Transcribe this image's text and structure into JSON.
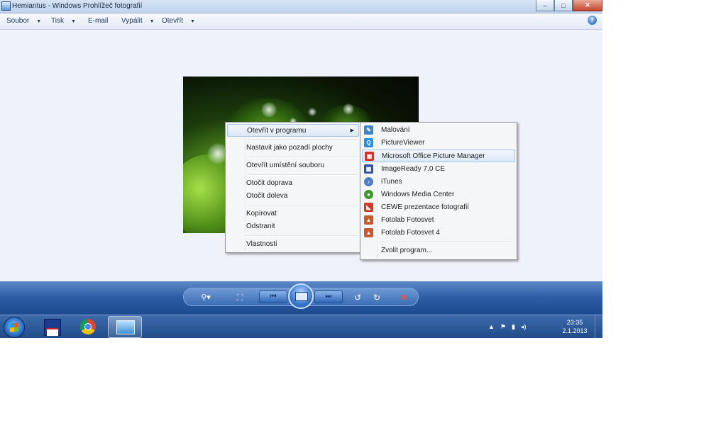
{
  "window": {
    "title": "Hemiantus - Windows Prohlížeč fotografií",
    "buttons": {
      "minimize": "–",
      "maximize": "□",
      "close": "✕"
    }
  },
  "menubar": {
    "items": [
      {
        "label": "Soubor"
      },
      {
        "label": "Tisk"
      },
      {
        "label": "E-mail"
      },
      {
        "label": "Vypálit"
      },
      {
        "label": "Otevřít"
      }
    ],
    "help_glyph": "?"
  },
  "context_menu": {
    "items": [
      {
        "label": "Otevřít v programu",
        "has_submenu": true,
        "highlighted": true
      },
      {
        "label": "Nastavit jako pozadí plochy"
      },
      {
        "label": "Otevřít umístění souboru"
      },
      {
        "label": "Otočit doprava"
      },
      {
        "label": "Otočit doleva"
      },
      {
        "label": "Kopírovat"
      },
      {
        "label": "Odstranit"
      },
      {
        "label": "Vlastnosti"
      }
    ],
    "submenu_arrow": "▶"
  },
  "submenu": {
    "items": [
      {
        "label": "Malování",
        "icon": "paint-icon",
        "color": "#3f86c9",
        "glyph": "✎"
      },
      {
        "label": "PictureViewer",
        "icon": "pictureviewer-icon",
        "color": "#2d8fe0",
        "glyph": "Q"
      },
      {
        "label": "Microsoft Office Picture Manager",
        "icon": "office-picture-manager-icon",
        "color": "#c7352b",
        "glyph": "▣",
        "highlighted": true
      },
      {
        "label": "ImageReady 7.0 CE",
        "icon": "imageready-icon",
        "color": "#3355a8",
        "glyph": "▦"
      },
      {
        "label": "iTunes",
        "icon": "itunes-icon",
        "color": "#4d7fc4",
        "glyph": "♪"
      },
      {
        "label": "Windows Media Center",
        "icon": "media-center-icon",
        "color": "#3a9a2c",
        "glyph": "●"
      },
      {
        "label": "CEWE prezentace fotografií",
        "icon": "cewe-icon",
        "color": "#d13a26",
        "glyph": "◣"
      },
      {
        "label": "Fotolab Fotosvet",
        "icon": "fotolab-icon",
        "color": "#c45a2d",
        "glyph": "▲"
      },
      {
        "label": "Fotolab Fotosvet 4",
        "icon": "fotolab4-icon",
        "color": "#c45a2d",
        "glyph": "▲"
      }
    ],
    "choose_program": "Zvolit program..."
  },
  "controls": {
    "zoom": "⚲▾",
    "actual_size": "⛶",
    "prev": "⏮",
    "next": "⏭",
    "rotate_left": "↺",
    "rotate_right": "↻",
    "delete": "✕"
  },
  "taskbar": {
    "tray_icons": [
      "▲",
      "⚑",
      "▮",
      "◂)"
    ],
    "time": "23:35",
    "date": "2.1.2013"
  }
}
